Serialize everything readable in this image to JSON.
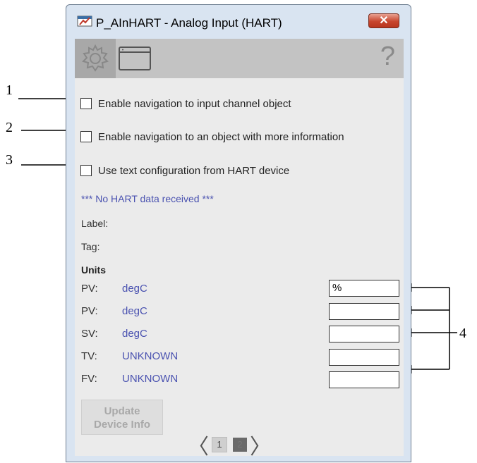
{
  "window": {
    "title": "P_AInHART - Analog Input (HART)",
    "close_label": "✕"
  },
  "toolbar": {
    "help_label": "?"
  },
  "options": [
    {
      "label": "Enable navigation to input channel object",
      "checked": false
    },
    {
      "label": "Enable navigation to an object with more information",
      "checked": false
    },
    {
      "label": "Use text configuration from HART device",
      "checked": false
    }
  ],
  "status_text": "*** No HART data received ***",
  "label_caption": "Label:",
  "tag_caption": "Tag:",
  "units": {
    "header": "Units",
    "rows": [
      {
        "name": "PV:",
        "value": "degC",
        "entry": "%"
      },
      {
        "name": "PV:",
        "value": "degC",
        "entry": ""
      },
      {
        "name": "SV:",
        "value": "degC",
        "entry": ""
      },
      {
        "name": "TV:",
        "value": "UNKNOWN",
        "entry": ""
      },
      {
        "name": "FV:",
        "value": "UNKNOWN",
        "entry": ""
      }
    ]
  },
  "update_button": {
    "line1": "Update",
    "line2": "Device Info"
  },
  "pager": {
    "prev": "〈",
    "next": "〉",
    "pages": [
      "1",
      "2"
    ],
    "current_page": "2"
  },
  "callouts": [
    "1",
    "2",
    "3",
    "4"
  ],
  "colors": {
    "window_bg": "#d9e4f1",
    "content_bg": "#ebebeb",
    "link_text": "#4a52b0",
    "close_red": "#c8452d"
  }
}
